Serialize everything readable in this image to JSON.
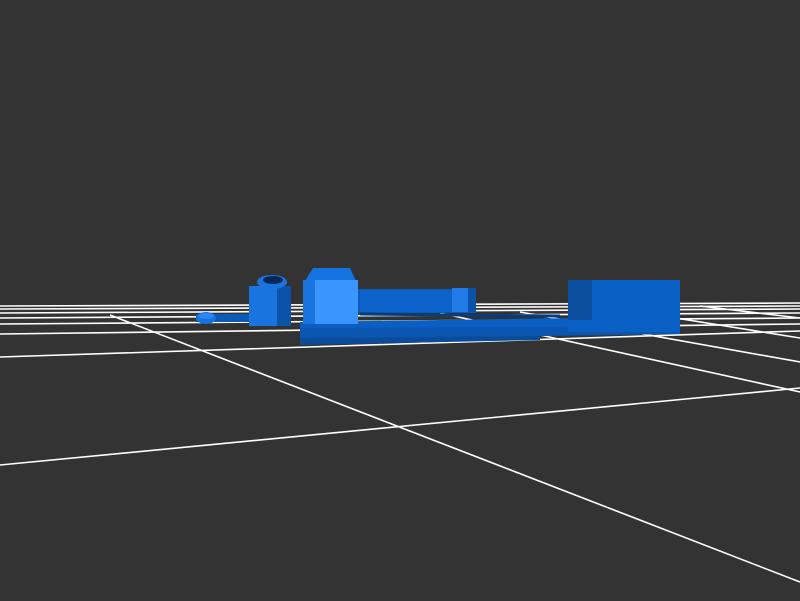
{
  "scene": {
    "background_color": "#333333",
    "grid_color": "#ffffff",
    "model_colors": {
      "base": "#0a5fc4",
      "dark": "#0b4f9e",
      "mid": "#0d63c9",
      "light": "#2a86f0",
      "bright": "#3b95ff",
      "shadow": "#083c7a"
    }
  }
}
